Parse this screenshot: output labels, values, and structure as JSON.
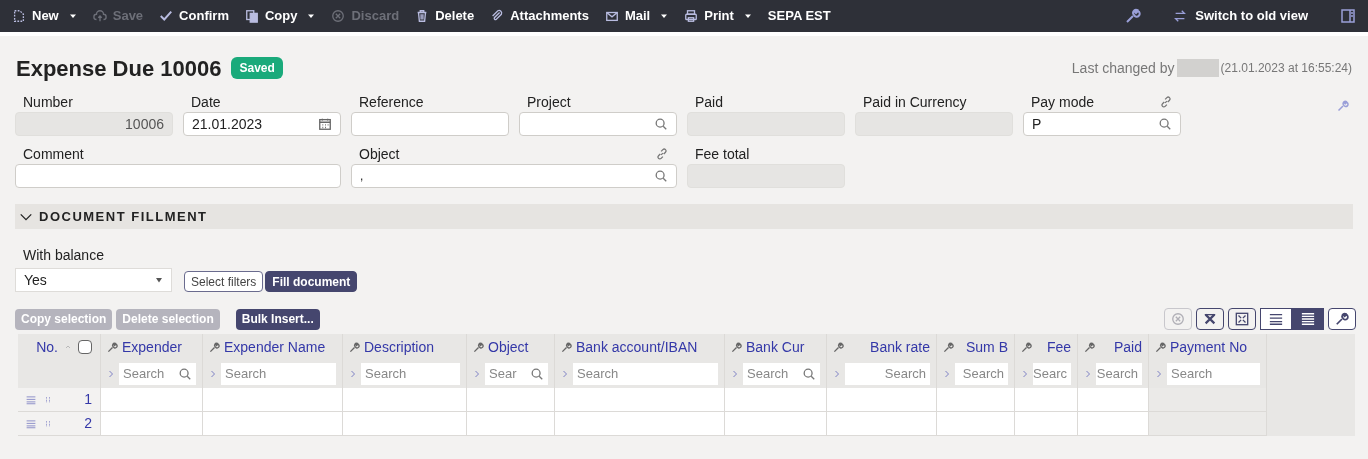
{
  "toolbar": {
    "items": [
      {
        "label": "New",
        "disabled": false,
        "menu": true
      },
      {
        "label": "Save",
        "disabled": true,
        "menu": false
      },
      {
        "label": "Confirm",
        "disabled": false,
        "menu": false
      },
      {
        "label": "Copy",
        "disabled": false,
        "menu": true
      },
      {
        "label": "Discard",
        "disabled": true,
        "menu": false
      },
      {
        "label": "Delete",
        "disabled": false,
        "menu": false
      },
      {
        "label": "Attachments",
        "disabled": false,
        "menu": false
      },
      {
        "label": "Mail",
        "disabled": false,
        "menu": true
      },
      {
        "label": "Print",
        "disabled": false,
        "menu": true
      },
      {
        "label": "SEPA EST",
        "disabled": false,
        "menu": false
      }
    ],
    "switch_view": "Switch to old view"
  },
  "header": {
    "title": "Expense Due 10006",
    "status": "Saved",
    "last_changed": "Last changed by",
    "timestamp": "(21.01.2023 at 16:55:24)"
  },
  "fields": [
    {
      "label": "Number",
      "value": "10006",
      "kind": "number",
      "disabled": true
    },
    {
      "label": "Date",
      "value": "21.01.2023",
      "kind": "date",
      "disabled": false
    },
    {
      "label": "Reference",
      "kind": "text",
      "disabled": false
    },
    {
      "label": "Project",
      "kind": "lookup",
      "disabled": false
    },
    {
      "label": "Paid",
      "kind": "text",
      "disabled": true
    },
    {
      "label": "Paid in Currency",
      "kind": "text",
      "disabled": true
    },
    {
      "label": "Pay mode",
      "value": "P",
      "kind": "lookup",
      "disabled": false,
      "link": true
    },
    {
      "label": "Comment",
      "kind": "wide",
      "disabled": false
    },
    {
      "label": "Object",
      "value": ",",
      "kind": "widelookup",
      "disabled": false,
      "link": true
    },
    {
      "label": "Fee total",
      "kind": "text",
      "disabled": true
    }
  ],
  "fillment": {
    "title": "DOCUMENT FILLMENT",
    "expanded": true,
    "balance_label": "With balance",
    "balance_value": "Yes",
    "buttons": [
      {
        "label": "Select filters",
        "primary": false
      },
      {
        "label": "Fill document",
        "primary": true
      }
    ]
  },
  "grid_actions": [
    {
      "label": "Copy selection",
      "disabled": true
    },
    {
      "label": "Delete selection",
      "disabled": true
    },
    {
      "label": "Bulk Insert...",
      "disabled": false
    }
  ],
  "grid_tools": {
    "clear_disabled": true,
    "views": [
      {
        "selected": false
      },
      {
        "selected": true
      }
    ]
  },
  "table": {
    "columns": [
      {
        "label": "Expender",
        "placeholder": "Search",
        "search_icon": true,
        "numeric": false
      },
      {
        "label": "Expender Name",
        "placeholder": "Search",
        "search_icon": false,
        "numeric": false
      },
      {
        "label": "Description",
        "placeholder": "Search",
        "search_icon": false,
        "numeric": false
      },
      {
        "label": "Object",
        "placeholder": "Sear",
        "search_icon": true,
        "numeric": false
      },
      {
        "label": "Bank account/IBAN",
        "placeholder": "Search",
        "search_icon": false,
        "numeric": false
      },
      {
        "label": "Bank Cur",
        "placeholder": "Search",
        "search_icon": true,
        "numeric": false
      },
      {
        "label": "Bank rate",
        "placeholder": "Search",
        "search_icon": false,
        "numeric": true
      },
      {
        "label": "Sum B",
        "placeholder": "Search",
        "search_icon": false,
        "numeric": true
      },
      {
        "label": "Fee",
        "placeholder": "Searc",
        "search_icon": false,
        "numeric": true
      },
      {
        "label": "Paid",
        "placeholder": "Search",
        "search_icon": false,
        "numeric": true
      },
      {
        "label": "Payment No",
        "placeholder": "Search",
        "search_icon": false,
        "numeric": false
      }
    ],
    "no_label": "No.",
    "select_all": false,
    "rows": [
      {
        "no": "1"
      },
      {
        "no": "2"
      }
    ]
  }
}
